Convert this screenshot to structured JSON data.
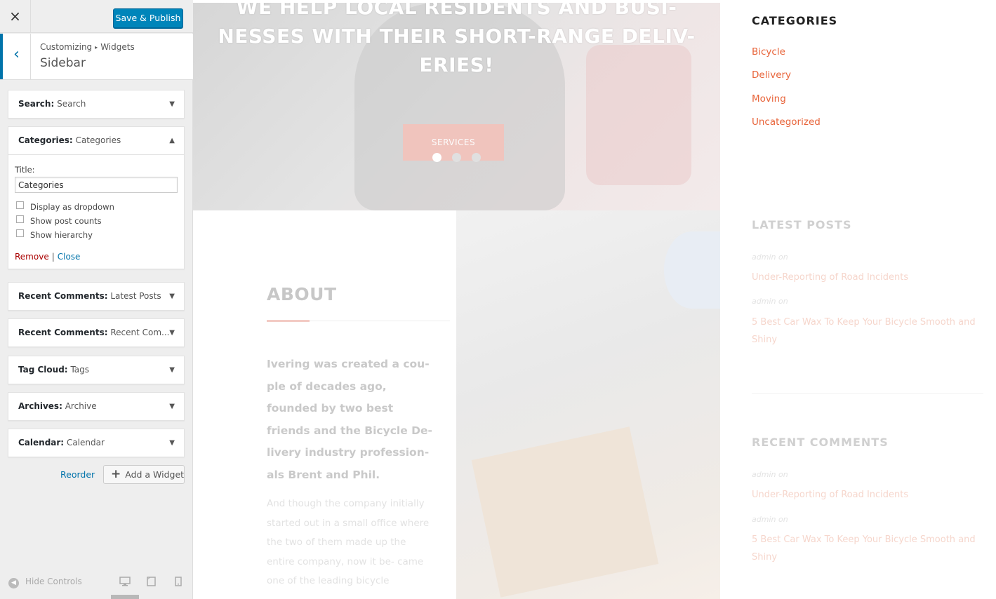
{
  "panel": {
    "close_icon": "×",
    "save_label": "Save & Publish",
    "back_icon": "‹",
    "breadcrumb": [
      "Customizing",
      "Widgets"
    ],
    "breadcrumb_sep": "▸",
    "section_title": "Sidebar",
    "widgets": [
      {
        "type": "Search:",
        "title": "Search"
      },
      {
        "type": "Categories:",
        "title": "Categories"
      },
      {
        "type": "Recent Comments:",
        "title": "Latest Posts"
      },
      {
        "type": "Recent Comments:",
        "title": "Recent Com..."
      },
      {
        "type": "Tag Cloud:",
        "title": "Tags"
      },
      {
        "type": "Archives:",
        "title": "Archive"
      },
      {
        "type": "Calendar:",
        "title": "Calendar"
      }
    ],
    "arrow_down": "▼",
    "arrow_up": "▲",
    "categories_form": {
      "title_label": "Title:",
      "title_value": "Categories",
      "options": [
        {
          "label": "Display as dropdown",
          "checked": false
        },
        {
          "label": "Show post counts",
          "checked": false
        },
        {
          "label": "Show hierarchy",
          "checked": false
        }
      ],
      "remove_label": "Remove",
      "separator": "|",
      "close_label": "Close"
    },
    "reorder_label": "Reorder",
    "add_widget_label": "Add a Widget",
    "add_widget_icon": "+",
    "hide_controls_label": "Hide Controls",
    "hide_controls_icon": "◀",
    "device_icons": [
      "desktop-icon",
      "tablet-icon",
      "mobile-icon"
    ]
  },
  "preview": {
    "hero_lines": [
      "WE HELP LOCAL RESIDENTS AND BUSI-",
      "NESSES WITH THEIR SHORT-RANGE DELIV-",
      "ERIES!"
    ],
    "services_label": "SERVICES",
    "about_title": "ABOUT",
    "about_lead": "Ivering was created a cou- ple of decades ago, founded by two best friends and the Bicycle De- livery industry profession- als Brent and Phil.",
    "about_body": "And though the company initially started out in a small office where the two of them made up the entire company, now it be- came one of the leading bicycle",
    "categories_heading": "CATEGORIES",
    "categories": [
      "Bicycle",
      "Delivery",
      "Moving",
      "Uncategorized"
    ],
    "latest_posts_heading": "LATEST POSTS",
    "latest_posts": [
      {
        "meta": "admin  on",
        "title": "Under-Reporting of Road Incidents"
      },
      {
        "meta": "admin  on",
        "title": "5 Best Car Wax To Keep Your Bicycle Smooth and Shiny"
      }
    ],
    "recent_comments_heading": "RECENT COMMENTS",
    "recent_comments": [
      {
        "meta": "admin  on",
        "title": "Under-Reporting of Road Incidents"
      },
      {
        "meta": "admin  on",
        "title": "5 Best Car Wax To Keep Your Bicycle Smooth and Shiny"
      }
    ]
  },
  "colors": {
    "accent": "#0085ba",
    "link": "#0073aa",
    "remove": "#aa0000",
    "category_link": "#e8643a"
  }
}
